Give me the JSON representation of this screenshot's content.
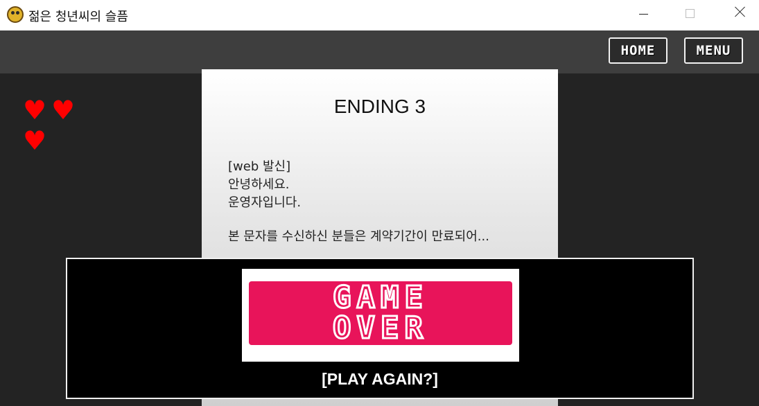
{
  "window": {
    "title": "젊은 청년씨의 슬픔",
    "icon": "pygame-snake-icon"
  },
  "header": {
    "home_label": "HOME",
    "menu_label": "MENU"
  },
  "lives": {
    "count": 3,
    "symbol": "♥",
    "color": "#ff0000"
  },
  "ending": {
    "title": "ENDING 3",
    "lines": [
      "[web 발신]",
      "안녕하세요.",
      "운영자입니다.",
      "본 문자를 수신하신 분들은 계약기간이 만료되어..."
    ]
  },
  "game_over": {
    "word1": "GAME",
    "word2": "OVER",
    "accent_color": "#e8145a",
    "play_again_label": "[PLAY AGAIN?]"
  }
}
